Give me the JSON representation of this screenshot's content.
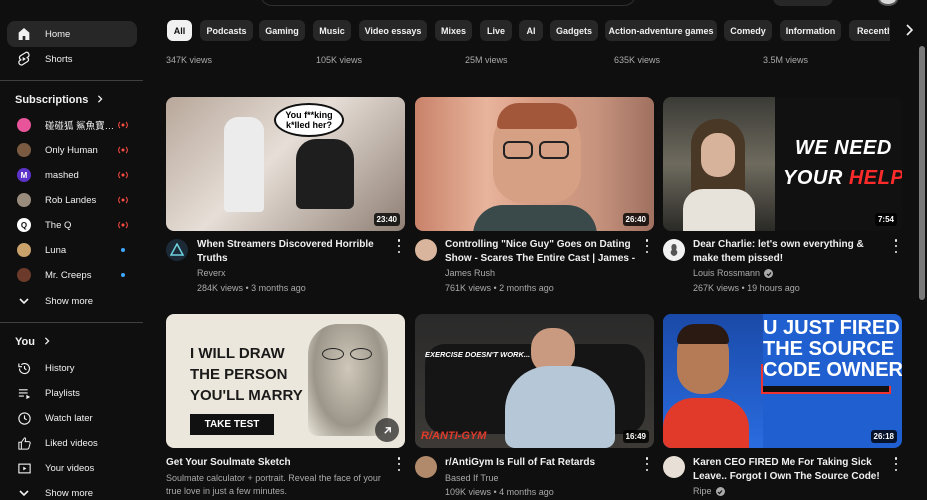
{
  "sidebar": {
    "items_main": [
      {
        "label": "Home",
        "icon": "home-icon"
      },
      {
        "label": "Shorts",
        "icon": "shorts-icon"
      }
    ],
    "subscriptions_heading": "Subscriptions",
    "subscriptions": [
      {
        "label": "碰碰狐 鯊魚寶寶 ...",
        "status": "live",
        "avatar_color": "#e7549a"
      },
      {
        "label": "Only Human",
        "status": "live",
        "avatar_color": "#7a5a40"
      },
      {
        "label": "mashed",
        "status": "live",
        "avatar_color": "#5b33c9"
      },
      {
        "label": "Rob Landes",
        "status": "live",
        "avatar_color": "#9a8c7c"
      },
      {
        "label": "The Q",
        "status": "live",
        "avatar_color": "#ffffff"
      },
      {
        "label": "Luna",
        "status": "new",
        "avatar_color": "#c9a16b"
      },
      {
        "label": "Mr. Creeps",
        "status": "new",
        "avatar_color": "#6b3a2a"
      }
    ],
    "show_more_1": "Show more",
    "you_heading": "You",
    "you_items": [
      {
        "label": "History",
        "icon": "history-icon"
      },
      {
        "label": "Playlists",
        "icon": "playlists-icon"
      },
      {
        "label": "Watch later",
        "icon": "watch-later-icon"
      },
      {
        "label": "Liked videos",
        "icon": "liked-icon"
      },
      {
        "label": "Your videos",
        "icon": "your-videos-icon"
      }
    ],
    "show_more_2": "Show more"
  },
  "chips": [
    "All",
    "Podcasts",
    "Gaming",
    "Music",
    "Video essays",
    "Mixes",
    "Live",
    "AI",
    "Gadgets",
    "Action-adventure games",
    "Comedy",
    "Information",
    "Recently"
  ],
  "prev_row_views": [
    "347K views",
    "105K views",
    "25M views",
    "635K views",
    "3.5M views"
  ],
  "videos": [
    {
      "title": "When Streamers Discovered Horrible Truths",
      "channel": "Reverx",
      "verified": false,
      "meta": "284K views • 3 months ago",
      "duration": "23:40",
      "overlay": "You f**king k*lled her?"
    },
    {
      "title": "Controlling \"Nice Guy\" Goes on Dating Show - Scares The Entire Cast  | James - ...",
      "channel": "James Rush",
      "verified": false,
      "meta": "761K views • 2 months ago",
      "duration": "26:40",
      "overlay": ""
    },
    {
      "title": "Dear Charlie: let's own everything & make them pissed!",
      "channel": "Louis Rossmann",
      "verified": true,
      "meta": "267K views • 19 hours ago",
      "duration": "7:54",
      "overlay_line1": "WE NEED",
      "overlay_line2a": "YOUR ",
      "overlay_line2b": "HELP!"
    },
    {
      "title": "Get Your Soulmate Sketch",
      "channel": "",
      "verified": false,
      "meta": "Soulmate calculator + portrait. Reveal the face of your true love in just a few minutes.",
      "duration": "",
      "overlay_lines": [
        "I WILL DRAW",
        "THE PERSON",
        "YOU'LL MARRY"
      ],
      "cta": "TAKE TEST"
    },
    {
      "title": "r/AntiGym Is Full of Fat Retards",
      "channel": "Based If True",
      "verified": false,
      "meta": "109K views • 4 months ago",
      "duration": "16:49",
      "overlay_top": "EXERCISE DOESN'T WORK...",
      "overlay_bottom": "R/ANTI-GYM"
    },
    {
      "title": "Karen CEO FIRED Me For Taking Sick Leave.. Forgot I Own The Source Code!",
      "channel": "Ripe",
      "verified": true,
      "meta": "",
      "duration": "26:18",
      "overlay_lines": [
        "U JUST FIRED",
        "THE SOURCE",
        "CODE OWNER!"
      ]
    }
  ]
}
